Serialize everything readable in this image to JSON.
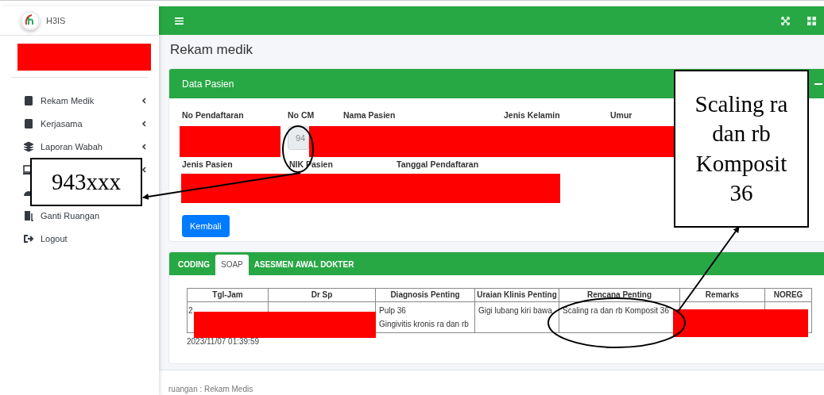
{
  "app": {
    "name": "H3IS"
  },
  "sidebar": {
    "items": [
      {
        "label": "Rekam Medik",
        "submenu": true
      },
      {
        "label": "Kerjasama",
        "submenu": true
      },
      {
        "label": "Laporan Wabah",
        "submenu": true
      },
      {
        "submenu": true
      },
      {
        "submenu": false
      },
      {
        "label": "Ganti Ruangan",
        "submenu": false
      },
      {
        "label": "Logout",
        "submenu": false
      }
    ]
  },
  "page_title": "Rekam medik",
  "patient_card": {
    "title": "Data Pasien",
    "row_1": [
      {
        "label": "No Pendaftaran"
      },
      {
        "label": "No CM",
        "value": "94"
      },
      {
        "label": "Nama Pasien"
      },
      {
        "label": "Jenis Kelamin"
      },
      {
        "label": "Umur"
      }
    ],
    "row_2": [
      {
        "label": "Jenis Pasien"
      },
      {
        "label": "NIK Pasien"
      },
      {
        "label": "Tanggal Pendaftaran"
      }
    ],
    "button": "Kembali"
  },
  "tabs": [
    {
      "label": "CODING",
      "selected": false
    },
    {
      "label": "SOAP",
      "selected": true
    },
    {
      "label": "ASESMEN AWAL DOKTER",
      "selected": false
    }
  ],
  "table": {
    "columns": [
      "Tgl-Jam",
      "Dr Sp",
      "Diagnosis Penting",
      "Uraian Klinis Penting",
      "Rencana Penting",
      "Remarks",
      "NOREG"
    ],
    "rows": [
      {
        "cells": [
          {
            "lines": [
              "2"
            ]
          },
          {},
          {
            "lines": [
              "Pulp 36",
              "Gingivitis kronis ra dan rb"
            ]
          },
          {
            "lines": [
              "Gigi lubang kiri bawa"
            ]
          },
          {
            "lines": [
              "Scaling ra dan rb Komposit 36"
            ]
          },
          {},
          {}
        ]
      }
    ]
  },
  "timestamp": "2023/11/07 01:39:59",
  "footer": "ruangan : Rekam Medis",
  "annotations": [
    {
      "text": "943xxx"
    },
    {
      "text": "Scaling ra dan rb Komposit 36"
    }
  ]
}
